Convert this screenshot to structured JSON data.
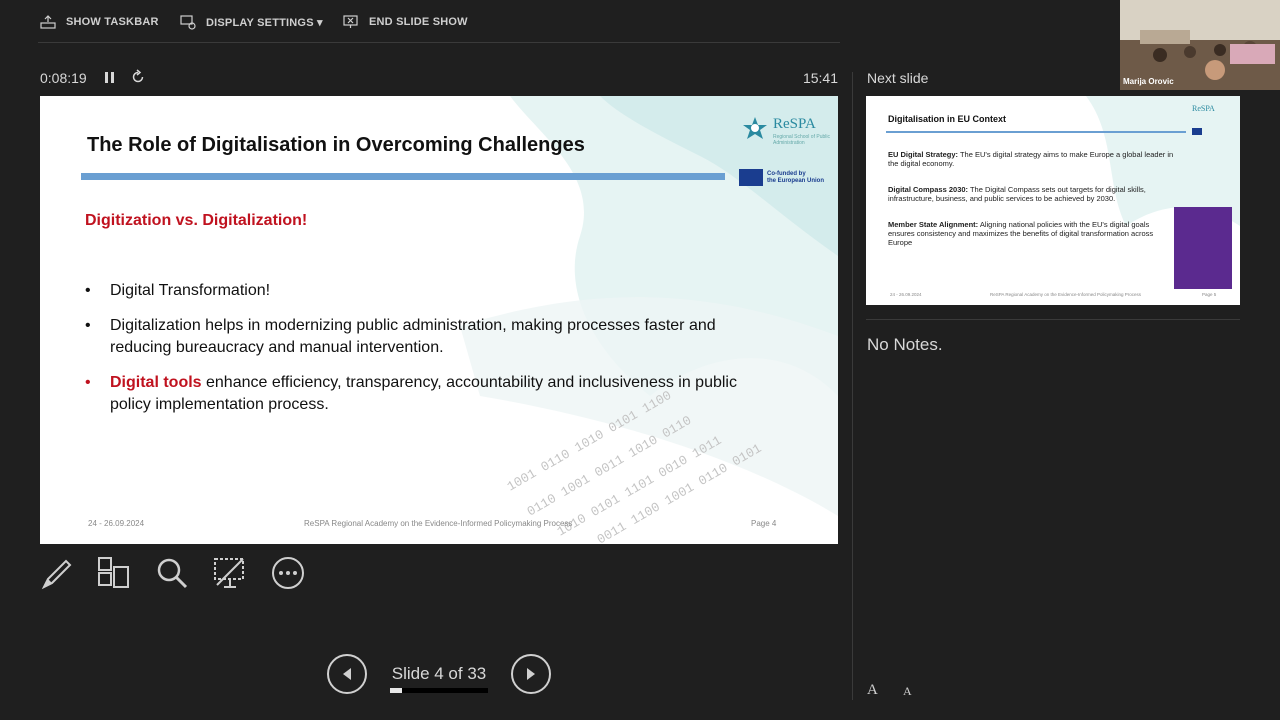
{
  "toolbar": {
    "show_taskbar": "SHOW TASKBAR",
    "display_settings": "DISPLAY SETTINGS ▾",
    "end_slide_show": "END SLIDE SHOW"
  },
  "timer": {
    "elapsed": "0:08:19",
    "clock": "15:41"
  },
  "next_slide_label": "Next slide",
  "current_slide": {
    "title": "The Role of Digitalisation in Overcoming Challenges",
    "logo_name": "ReSPA",
    "logo_sub": "Regional School of Public Administration",
    "eu_text_1": "Co-funded by",
    "eu_text_2": "the European Union",
    "subheading": "Digitization vs. Digitalization!",
    "bullet1": "Digital Transformation!",
    "bullet2": "Digitalization helps in modernizing public administration, making processes faster and reducing bureaucracy and manual intervention.",
    "bullet3_highlight": "Digital tools",
    "bullet3_rest": " enhance efficiency, transparency, accountability and inclusiveness in public policy implementation process.",
    "footer_date": "24 - 26.09.2024",
    "footer_center": "ReSPA Regional Academy on the Evidence-Informed Policymaking Process",
    "footer_page": "Page 4"
  },
  "next_slide": {
    "title": "Digitalisation in EU Context",
    "logo_name": "ReSPA",
    "p1_bold": "EU Digital Strategy:",
    "p1_text": " The EU's digital strategy aims to make Europe a global leader in the digital economy.",
    "p2_bold": "Digital Compass 2030:",
    "p2_text": " The Digital Compass sets out targets for digital skills, infrastructure, business, and public services to be achieved by 2030.",
    "p3_bold": "Member State Alignment:",
    "p3_text": " Aligning national policies with the EU's digital goals ensures consistency and maximizes the benefits of digital transformation across Europe",
    "footer_date": "24 - 26.09.2024",
    "footer_center": "ReSPA Regional Academy on the Evidence-Informed Policymaking Process",
    "footer_page": "Page 5"
  },
  "notes": "No Notes.",
  "navigation": {
    "slide_counter": "Slide 4 of 33",
    "progress_fraction": 0.12
  },
  "font_controls": {
    "increase": "A",
    "decrease": "A"
  },
  "webcam": {
    "participant_name": "Marija Orovic"
  },
  "colors": {
    "accent_red": "#c0121f",
    "bar_blue": "#6a9fd2",
    "background": "#1f1f1f"
  }
}
